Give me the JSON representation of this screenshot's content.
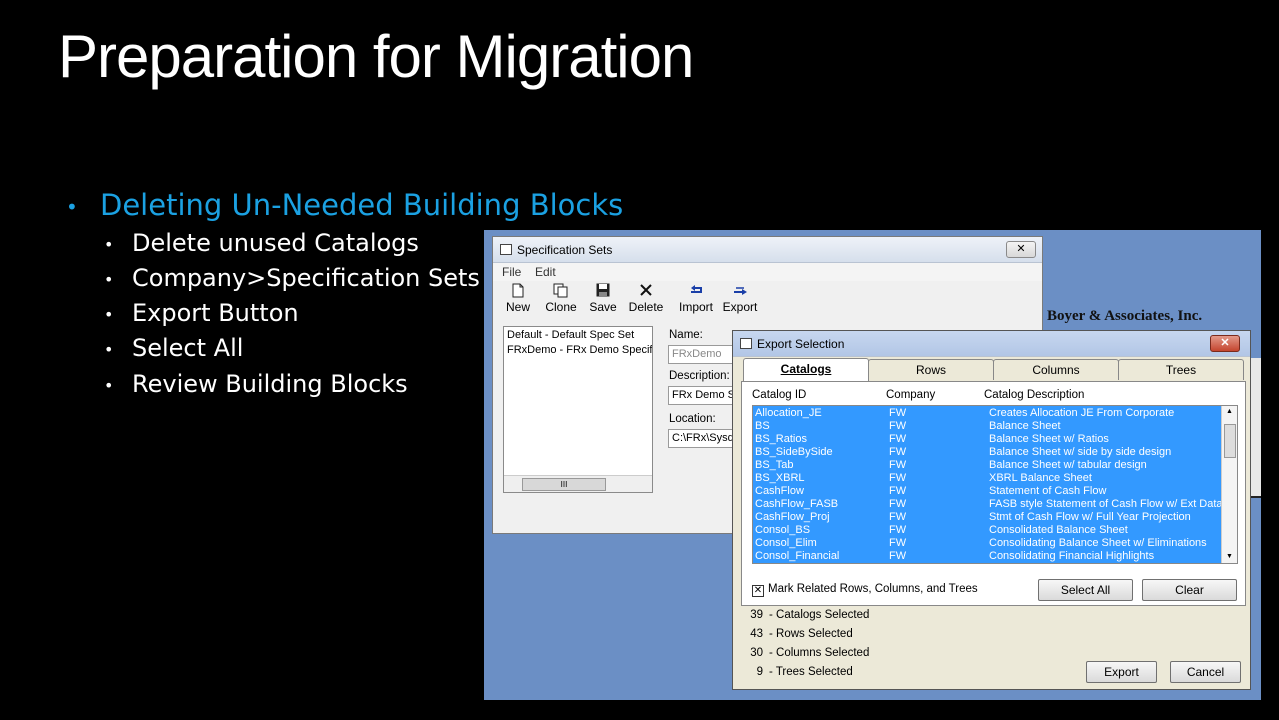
{
  "slide": {
    "title": "Preparation for Migration",
    "main_bullet": "Deleting Un-Needed Building Blocks",
    "sub_bullets": [
      "Delete unused Catalogs",
      "Company>Specification Sets",
      "Export Button",
      "Select All",
      "Review Building Blocks"
    ],
    "bullet_glyph": "•"
  },
  "background_app": {
    "company_name": "Boyer & Associates, Inc."
  },
  "spec_window": {
    "title": "Specification Sets",
    "close": "✕",
    "menu": [
      "File",
      "Edit"
    ],
    "toolbar": [
      {
        "label": "New",
        "icon": "new-document-icon"
      },
      {
        "label": "Clone",
        "icon": "clone-icon"
      },
      {
        "label": "Save",
        "icon": "save-disk-icon"
      },
      {
        "label": "Delete",
        "icon": "delete-x-icon"
      },
      {
        "label": "Import",
        "icon": "import-icon"
      },
      {
        "label": "Export",
        "icon": "export-icon"
      }
    ],
    "list": [
      "Default - Default Spec Set",
      "FRxDemo - FRx Demo Specific"
    ],
    "scroll_mark": "III",
    "name_label": "Name:",
    "name_value": "FRxDemo",
    "description_label": "Description:",
    "description_value": "FRx Demo Sp",
    "location_label": "Location:",
    "location_value": "C:\\FRx\\Sysd"
  },
  "export_window": {
    "title": "Export Selection",
    "close": "✕",
    "tabs": [
      "Catalogs",
      "Rows",
      "Columns",
      "Trees"
    ],
    "active_tab": "Catalogs",
    "columns": [
      "Catalog ID",
      "Company",
      "Catalog Description"
    ],
    "rows": [
      [
        "Allocation_JE",
        "FW",
        "Creates Allocation JE From Corporate"
      ],
      [
        "BS",
        "FW",
        "Balance Sheet"
      ],
      [
        "BS_Ratios",
        "FW",
        "Balance Sheet w/ Ratios"
      ],
      [
        "BS_SideBySide",
        "FW",
        "Balance Sheet w/ side by side design"
      ],
      [
        "BS_Tab",
        "FW",
        "Balance Sheet w/ tabular design"
      ],
      [
        "BS_XBRL",
        "FW",
        "XBRL Balance Sheet"
      ],
      [
        "CashFlow",
        "FW",
        "Statement of Cash Flow"
      ],
      [
        "CashFlow_FASB",
        "FW",
        "FASB style Statement of Cash Flow w/ Ext Data"
      ],
      [
        "CashFlow_Proj",
        "FW",
        "Stmt of Cash Flow w/ Full Year Projection"
      ],
      [
        "Consol_BS",
        "FW",
        "Consolidated Balance Sheet"
      ],
      [
        "Consol_Elim",
        "FW",
        "Consolidating Balance Sheet w/ Eliminations"
      ],
      [
        "Consol_Financial",
        "FW",
        "Consolidating Financial Highlights"
      ]
    ],
    "checkbox_label": "Mark Related Rows, Columns, and Trees",
    "checkbox_checked": true,
    "select_all_label": "Select All",
    "clear_label": "Clear",
    "summary": [
      {
        "count": "39",
        "label": "- Catalogs Selected"
      },
      {
        "count": "43",
        "label": "- Rows Selected"
      },
      {
        "count": "30",
        "label": "- Columns Selected"
      },
      {
        "count": "9",
        "label": "- Trees Selected"
      }
    ],
    "export_label": "Export",
    "cancel_label": "Cancel"
  }
}
